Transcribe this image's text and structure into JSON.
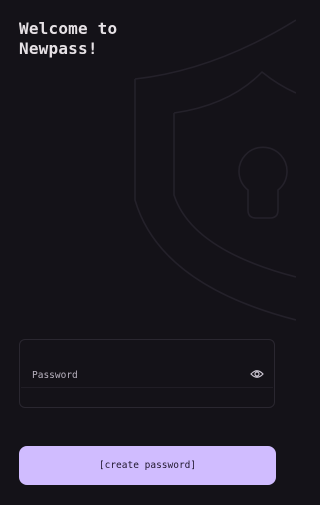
{
  "welcome": {
    "line1": "Welcome to",
    "line2": "Newpass!"
  },
  "password_field": {
    "placeholder": "Password",
    "value": ""
  },
  "create_button": {
    "label": "[create password]"
  },
  "icons": {
    "background": "shield-keyhole-icon",
    "visibility": "eye-icon"
  },
  "colors": {
    "background": "#141218",
    "accent": "#d0bcff",
    "text": "#e6e1e5"
  }
}
